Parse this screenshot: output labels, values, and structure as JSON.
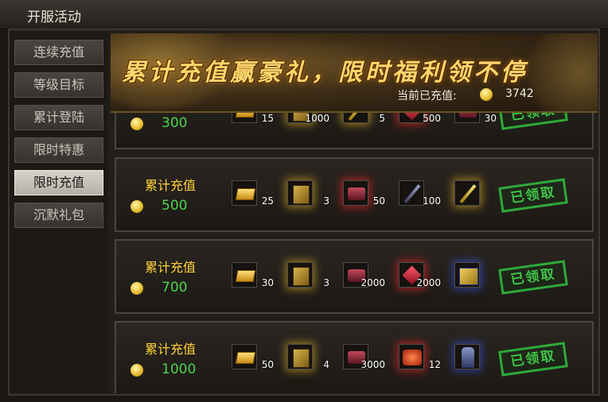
{
  "window": {
    "title": "开服活动"
  },
  "sidebar": {
    "items": [
      {
        "label": "连续充值",
        "active": false
      },
      {
        "label": "等级目标",
        "active": false
      },
      {
        "label": "累计登陆",
        "active": false
      },
      {
        "label": "限时特惠",
        "active": false
      },
      {
        "label": "限时充值",
        "active": true
      },
      {
        "label": "沉默礼包",
        "active": false
      }
    ]
  },
  "banner": {
    "slogan": "累计充值赢豪礼，限时福利领不停",
    "charged_label": "当前已充值:",
    "charged_amount": "3742"
  },
  "rows": [
    {
      "label": "",
      "amount": "300",
      "status": "已领取",
      "items": [
        {
          "icon": "gold-bar-icon",
          "qty": "15"
        },
        {
          "icon": "skill-book-icon",
          "qty": "1000"
        },
        {
          "icon": "gold-sword-icon",
          "qty": "5"
        },
        {
          "icon": "ruby-icon",
          "qty": "500"
        },
        {
          "icon": "ore-icon",
          "qty": "30"
        }
      ]
    },
    {
      "label": "累计充值",
      "amount": "500",
      "status": "已领取",
      "items": [
        {
          "icon": "gold-bar-icon",
          "qty": "25"
        },
        {
          "icon": "skill-book-icon",
          "qty": "3"
        },
        {
          "icon": "ore-icon",
          "qty": "50"
        },
        {
          "icon": "dark-sword-icon",
          "qty": "100"
        },
        {
          "icon": "gold-sword-icon",
          "qty": ""
        }
      ]
    },
    {
      "label": "累计充值",
      "amount": "700",
      "status": "已领取",
      "items": [
        {
          "icon": "gold-bar-icon",
          "qty": "30"
        },
        {
          "icon": "skill-book-icon",
          "qty": "3"
        },
        {
          "icon": "ore-icon",
          "qty": "2000"
        },
        {
          "icon": "ruby-icon",
          "qty": "2000"
        },
        {
          "icon": "scroll-icon",
          "qty": ""
        }
      ]
    },
    {
      "label": "累计充值",
      "amount": "1000",
      "status": "已领取",
      "items": [
        {
          "icon": "gold-bar-icon",
          "qty": "50"
        },
        {
          "icon": "skill-book-icon",
          "qty": "4"
        },
        {
          "icon": "ore-icon",
          "qty": "3000"
        },
        {
          "icon": "treasure-chest-icon",
          "qty": "12"
        },
        {
          "icon": "hero-figure-icon",
          "qty": ""
        }
      ]
    }
  ],
  "colors": {
    "amount": "#4cd54c",
    "label": "#ffd23a",
    "stamp": "#3ec448",
    "slogan": "#ffd66a"
  }
}
